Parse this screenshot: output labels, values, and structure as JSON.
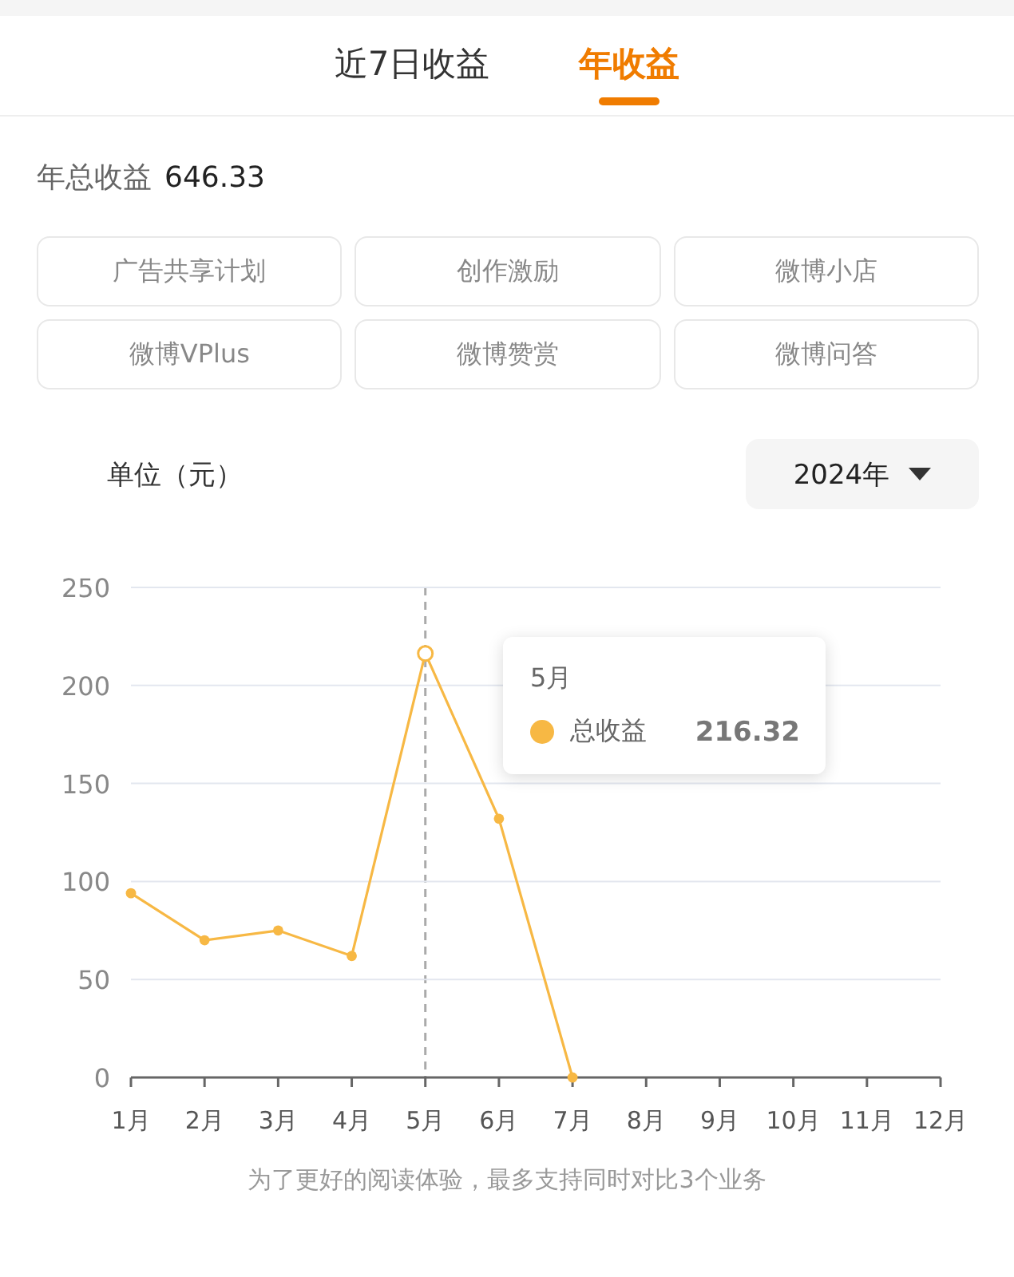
{
  "tabs": [
    {
      "label": "近7日收益",
      "selected": false
    },
    {
      "label": "年收益",
      "selected": true
    }
  ],
  "summary": {
    "label": "年总收益",
    "value": "646.33"
  },
  "business_filters": [
    {
      "label": "广告共享计划",
      "selected": false
    },
    {
      "label": "创作激励",
      "selected": false
    },
    {
      "label": "微博小店",
      "selected": false
    },
    {
      "label": "微博VPlus",
      "selected": false
    },
    {
      "label": "微博赞赏",
      "selected": false
    },
    {
      "label": "微博问答",
      "selected": false
    }
  ],
  "unit_label": "单位（元）",
  "year_dropdown": {
    "value": "2024年"
  },
  "chart": {
    "chart_data": {
      "type": "line",
      "categories": [
        "1月",
        "2月",
        "3月",
        "4月",
        "5月",
        "6月",
        "7月",
        "8月",
        "9月",
        "10月",
        "11月",
        "12月"
      ],
      "series": [
        {
          "name": "总收益",
          "color": "#f7b844",
          "marker": true,
          "values": [
            94,
            70,
            75,
            62,
            216.32,
            132,
            0,
            null,
            null,
            null,
            null,
            null
          ]
        }
      ],
      "ylim": [
        0,
        250
      ],
      "yticks": [
        0,
        50,
        100,
        150,
        200,
        250
      ],
      "grid": true
    },
    "tooltip": {
      "title": "5月",
      "value": "216.32"
    }
  },
  "footnote": "为了更好的阅读体验，最多支持同时对比3个业务"
}
